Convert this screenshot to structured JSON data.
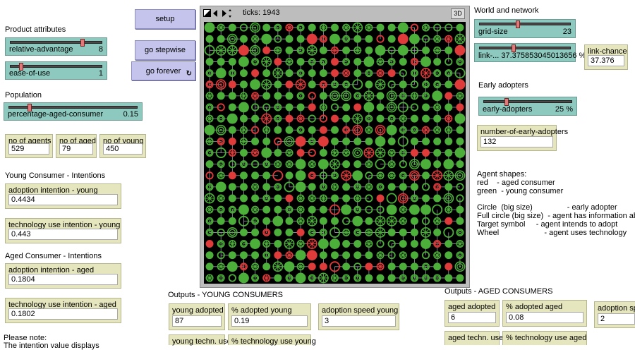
{
  "buttons": {
    "setup": "setup",
    "go_stepwise": "go stepwise",
    "go_forever": "go forever",
    "forever_glyph": "↻"
  },
  "sections": {
    "product_attributes": "Product attributes",
    "population": "Population",
    "young_intentions": "Young Consumer - Intentions",
    "aged_intentions": "Aged Consumer - Intentions",
    "please_note": "Please note:",
    "please_note_cut": "The intention value displays",
    "world_network": "World and network",
    "early_adopters": "Early adopters",
    "outputs_young": "Outputs - YOUNG CONSUMERS",
    "outputs_aged": "Outputs - AGED CONSUMERS"
  },
  "sliders": {
    "relative_advantage": {
      "name": "relative-advantage",
      "value": "8",
      "level": 0.8
    },
    "ease_of_use": {
      "name": "ease-of-use",
      "value": "1",
      "level": 0.1
    },
    "percentage_aged": {
      "name": "percentage-aged-consumer",
      "value": "0.15",
      "level": 0.15
    },
    "grid_size": {
      "name": "grid-size",
      "value": "23",
      "level": 0.42
    },
    "link_chance": {
      "name": "link-... 37.375853045013656 %",
      "value": "",
      "level": 0.37
    },
    "early_adopters": {
      "name": "early-adopters",
      "value": "25 %",
      "level": 0.25
    }
  },
  "monitors": {
    "no_agents": {
      "name": "no of agents",
      "value": "529"
    },
    "no_aged": {
      "name": "no of aged",
      "value": "79"
    },
    "no_young": {
      "name": "no of young",
      "value": "450"
    },
    "adoption_young": {
      "name": "adoption intention - young",
      "value": "0.4434"
    },
    "tech_use_young": {
      "name": "technology use intention - young",
      "value": "0.443"
    },
    "adoption_aged": {
      "name": "adoption intention - aged",
      "value": "0.1804"
    },
    "tech_use_aged": {
      "name": "technology use intention - aged",
      "value": "0.1802"
    },
    "link_chance": {
      "name": "link-chance",
      "value": "37.376"
    },
    "num_early": {
      "name": "number-of-early-adopters",
      "value": "132"
    },
    "young_adopted": {
      "name": "young adopted",
      "value": "87"
    },
    "pct_adopted_young": {
      "name": "% adopted young",
      "value": "0.19"
    },
    "adoption_speed_young": {
      "name": "adoption speed young",
      "value": "3"
    },
    "young_techn_use": {
      "name": "young techn. use",
      "value": ""
    },
    "pct_tech_use_young": {
      "name": "% technology use young",
      "value": ""
    },
    "aged_adopted": {
      "name": "aged adopted",
      "value": "6"
    },
    "pct_adopted_aged": {
      "name": "% adopted aged",
      "value": "0.08"
    },
    "adoption_speed_aged": {
      "name": "adoption spe",
      "value": "2"
    },
    "aged_techn_use": {
      "name": "aged techn. use",
      "value": ""
    },
    "pct_tech_use_aged": {
      "name": "% technology use aged",
      "value": ""
    }
  },
  "view": {
    "ticks": "ticks: 1943",
    "btn_3d": "3D"
  },
  "legend": {
    "title": "Agent shapes:",
    "red": "red    - aged consumer",
    "green": "green  - young consumer",
    "circle": "Circle  (big size)                - early adopter",
    "full_circle": "Full circle (big size)  - agent has information about innov",
    "target": "Target symbol     - agent intends to adopt",
    "wheel": "Wheel                     - agent uses technology"
  },
  "colors": {
    "young": "#4caf3a",
    "aged": "#e03b3b",
    "link": "#9a9aa8"
  }
}
